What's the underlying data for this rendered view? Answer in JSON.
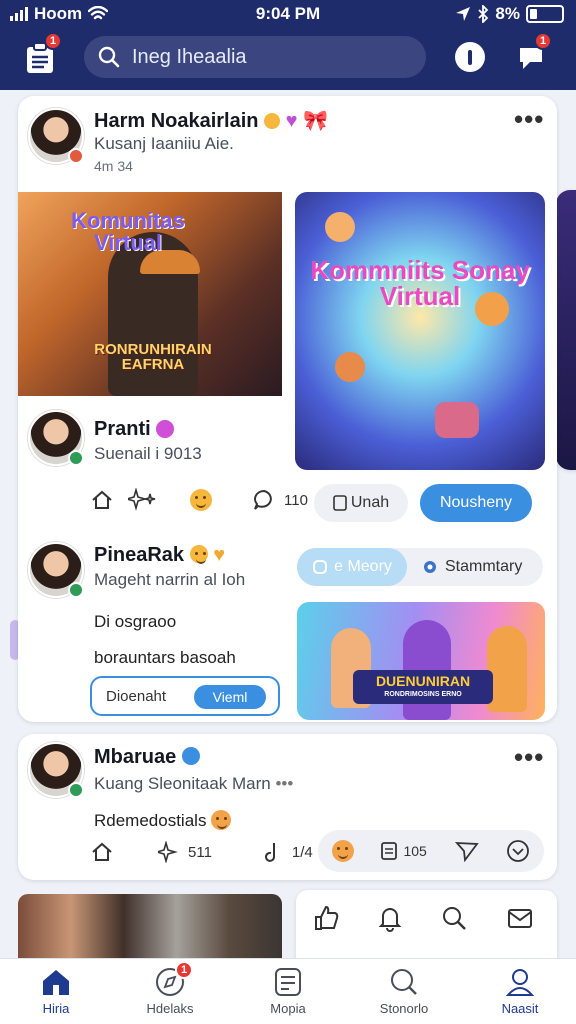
{
  "status_bar": {
    "carrier": "Hoom",
    "time": "9:04 PM",
    "battery": "8%"
  },
  "header": {
    "search_text": "Ineg Iheaalia",
    "notifications_badge": "1",
    "messages_badge": "1"
  },
  "post1": {
    "author": "Harm Noakairlain",
    "subtitle": "Kusanj Iaaniiu Aie.",
    "time": "4m 34",
    "media_left_title": "Komunitas Virtual",
    "media_left_banner": "RONRUNHIRAIN EAFRNA",
    "media_right_title": "Kommniits Sonay Virtual"
  },
  "comment1": {
    "author": "Pranti",
    "subtitle": "Suenail i 9013",
    "likes": "",
    "comments": "110",
    "pill_secondary": "Unah",
    "pill_primary": "Nousheny"
  },
  "comment2": {
    "author": "PineaRak",
    "subtitle": "Mageht narrin al Ioh",
    "line1": "Di osgraoo",
    "line2": "borauntars basoah",
    "input_text": "Dioenaht",
    "input_button": "Vieml",
    "chip1": "e Meory",
    "chip2": "Stammtary",
    "media_banner_title": "DUENUNIRAN",
    "media_banner_sub": "RONDRIMOSINS ERNO"
  },
  "post2": {
    "author": "Mbaruae",
    "subtitle": "Kuang Sleonitaak Marn",
    "text": "Rdemedostials",
    "count1": "511",
    "count2": "1/4",
    "count3": "105"
  },
  "bottom_nav": [
    {
      "label": "Hiria"
    },
    {
      "label": "Hdelaks"
    },
    {
      "label": "Mopia"
    },
    {
      "label": "Stonorlo"
    },
    {
      "label": "Naasit"
    }
  ],
  "bottom_nav_badge": "1",
  "colors": {
    "header": "#1f2c6b",
    "primary_button": "#3b8fe0",
    "accent_red": "#e53935"
  }
}
